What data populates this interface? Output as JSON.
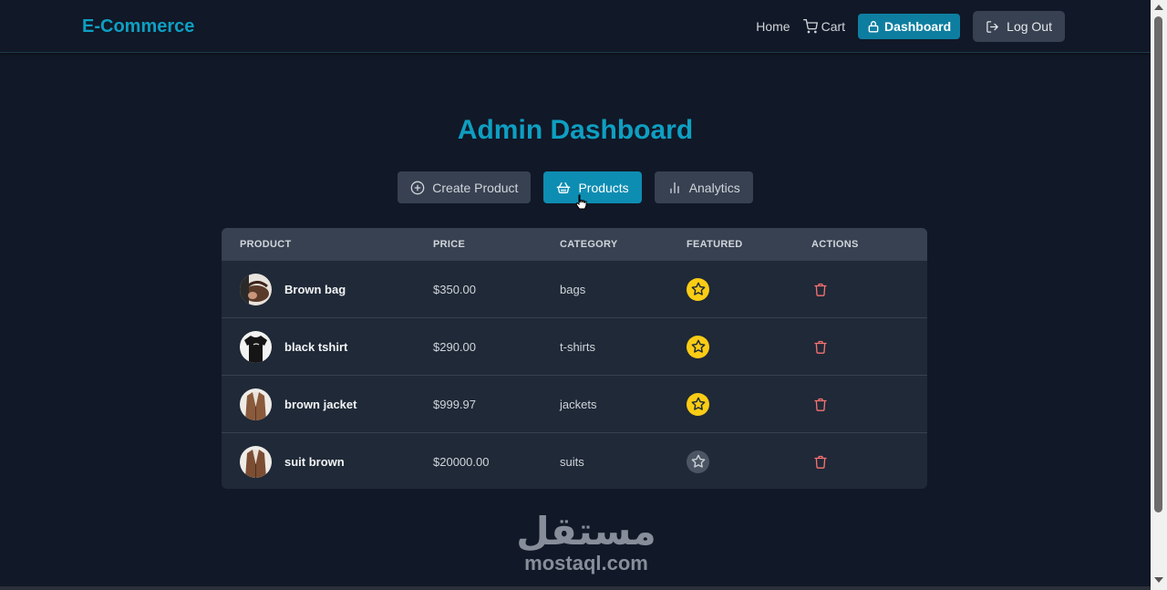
{
  "header": {
    "brand": "E-Commerce",
    "nav_home": "Home",
    "nav_cart": "Cart",
    "nav_dashboard": "Dashboard",
    "nav_logout": "Log Out"
  },
  "page": {
    "title": "Admin Dashboard"
  },
  "tabs": [
    {
      "label": "Create Product",
      "icon": "plus-circle-icon",
      "active": false
    },
    {
      "label": "Products",
      "icon": "basket-icon",
      "active": true
    },
    {
      "label": "Analytics",
      "icon": "bar-chart-icon",
      "active": false
    }
  ],
  "table": {
    "columns": [
      "PRODUCT",
      "PRICE",
      "CATEGORY",
      "FEATURED",
      "ACTIONS"
    ],
    "rows": [
      {
        "name": "Brown bag",
        "price": "$350.00",
        "category": "bags",
        "featured": true
      },
      {
        "name": "black tshirt",
        "price": "$290.00",
        "category": "t-shirts",
        "featured": true
      },
      {
        "name": "brown jacket",
        "price": "$999.97",
        "category": "jackets",
        "featured": true
      },
      {
        "name": "suit brown",
        "price": "$20000.00",
        "category": "suits",
        "featured": false
      }
    ]
  },
  "watermark": {
    "arabic": "مستقل",
    "latin": "mostaql.com"
  },
  "colors": {
    "accent": "#0e9fc2",
    "active_tab": "#0e8db3",
    "featured_star": "#facc15",
    "unfeatured_star": "#4b5563",
    "delete": "#f87171",
    "background": "#111827",
    "card": "#1f2937"
  }
}
